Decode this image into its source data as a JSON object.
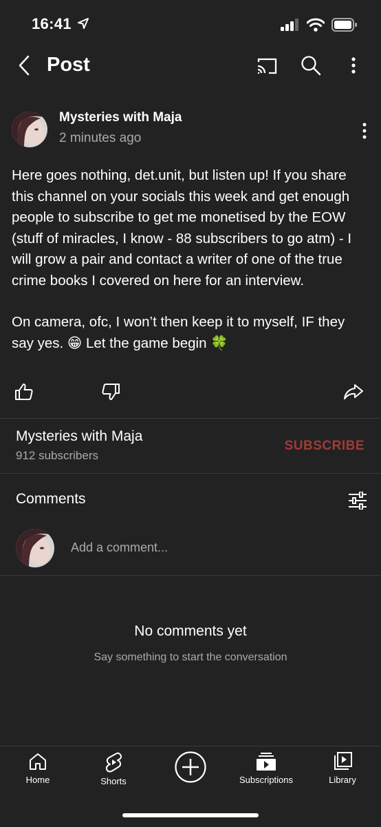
{
  "status_bar": {
    "time": "16:41"
  },
  "header": {
    "title": "Post"
  },
  "post": {
    "channel_name": "Mysteries with Maja",
    "timestamp": "2 minutes ago",
    "paragraph_1": "Here goes nothing, det.unit, but listen up! If you share this channel on your socials this week and get enough people to subscribe to get me monetised by the EOW (stuff of miracles, I know - 88 subscribers to go atm) - I will grow a pair and contact a writer of one of the true crime books I covered on here for an interview.",
    "paragraph_2": "On camera, ofc, I won’t then keep it to myself, IF they say yes. 😁 Let the game begin 🍀"
  },
  "channel": {
    "name": "Mysteries with Maja",
    "subscribers": "912 subscribers",
    "subscribe_label": "SUBSCRIBE",
    "subscribe_color": "#a33a33"
  },
  "comments": {
    "title": "Comments",
    "placeholder": "Add a comment...",
    "empty_title": "No comments yet",
    "empty_subtitle": "Say something to start the conversation"
  },
  "bottom_nav": {
    "items": [
      {
        "label": "Home",
        "icon": "home-icon"
      },
      {
        "label": "Shorts",
        "icon": "shorts-icon"
      },
      {
        "label": "",
        "icon": "create-icon"
      },
      {
        "label": "Subscriptions",
        "icon": "subscriptions-icon"
      },
      {
        "label": "Library",
        "icon": "library-icon"
      }
    ]
  }
}
